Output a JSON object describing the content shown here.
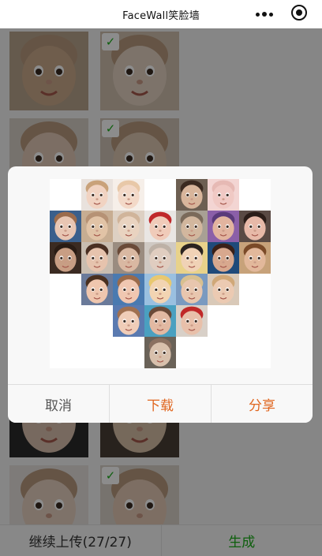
{
  "app": {
    "title": "FaceWall笑脸墙"
  },
  "titlebar": {
    "more_icon": "more-dots-icon",
    "capsule_icon": "target-circle-icon"
  },
  "grid": {
    "photos": [
      {
        "selected": false,
        "skin": "#caa98a",
        "bg": "#b9a48c"
      },
      {
        "selected": true,
        "skin": "#e3d2c2",
        "bg": "#cfc0ae"
      },
      {
        "selected": false,
        "skin": "#e2c8b6",
        "bg": "#d8cfc7"
      },
      {
        "selected": true,
        "skin": "#ddc6b1",
        "bg": "#cfc4b6"
      },
      {
        "selected": false,
        "skin": "#d9c0ad",
        "bg": "#2a2a2a"
      },
      {
        "selected": false,
        "skin": "#d7c0a7",
        "bg": "#4a3f36"
      },
      {
        "selected": false,
        "skin": "#e6cfc0",
        "bg": "#e6e0dc"
      },
      {
        "selected": true,
        "skin": "#e4c9b5",
        "bg": "#d9d2c8"
      }
    ],
    "check_mark": "✓"
  },
  "toolbar": {
    "continue_label": "继续上传(27/27)",
    "generate_label": "生成",
    "generate_color": "#1aad19"
  },
  "modal": {
    "cancel_label": "取消",
    "download_label": "下载",
    "share_label": "分享",
    "accent_color": "#e0661f",
    "faces": [
      {
        "skin": "#f1d3c2",
        "hair": "#c9a27a",
        "bg": "#e9e2dd"
      },
      {
        "skin": "#f3d9c8",
        "hair": "#e8c8a8",
        "bg": "#f6efe9"
      },
      {
        "skin": "#d8b59b",
        "hair": "#3b2a20",
        "bg": "#6d5f52"
      },
      {
        "skin": "#f0c9c4",
        "hair": "#e6b9b4",
        "bg": "#f3d5d3"
      },
      {
        "skin": "#e8c6b3",
        "hair": "#9b6b4c",
        "bg": "#3a5f8c"
      },
      {
        "skin": "#e1c3a6",
        "hair": "#b69275",
        "bg": "#c7ad92"
      },
      {
        "skin": "#e9d3c0",
        "hair": "#d0b49a",
        "bg": "#ddd0c3"
      },
      {
        "skin": "#f0cbb9",
        "hair": "#c0282a",
        "bg": "#e9e6e3"
      },
      {
        "skin": "#d2b79e",
        "hair": "#7a6a5a",
        "bg": "#a8a094"
      },
      {
        "skin": "#e2b49f",
        "hair": "#5a3a7a",
        "bg": "#8b5fa8"
      },
      {
        "skin": "#e7b9a8",
        "hair": "#2b1d18",
        "bg": "#5a4a44"
      },
      {
        "skin": "#c89e84",
        "hair": "#2a1c14",
        "bg": "#3b2b22"
      },
      {
        "skin": "#e6c3ad",
        "hair": "#4a2f22",
        "bg": "#c9bdb0"
      },
      {
        "skin": "#d9b8a2",
        "hair": "#6a4a38",
        "bg": "#9a8c80"
      },
      {
        "skin": "#e0cdc0",
        "hair": "#bdb1a6",
        "bg": "#cfc9c3"
      },
      {
        "skin": "#f0d2b6",
        "hair": "#2a2320",
        "bg": "#e8d28a"
      },
      {
        "skin": "#d8a88e",
        "hair": "#3a2018",
        "bg": "#1f4a7a"
      },
      {
        "skin": "#e2b89b",
        "hair": "#7a4a28",
        "bg": "#c7a27a"
      },
      {
        "skin": "#efc6ae",
        "hair": "#4a3020",
        "bg": "#6a7a9a"
      },
      {
        "skin": "#f0c7b1",
        "hair": "#9a6a4a",
        "bg": "#4a7ab0"
      },
      {
        "skin": "#f2d4b2",
        "hair": "#e8c870",
        "bg": "#9ac0e0"
      },
      {
        "skin": "#e8c6ae",
        "hair": "#d8c090",
        "bg": "#7a9ac0"
      },
      {
        "skin": "#eccab2",
        "hair": "#d0a878",
        "bg": "#d9c9b8"
      },
      {
        "skin": "#f0cdb8",
        "hair": "#a07050",
        "bg": "#5a7ab0"
      },
      {
        "skin": "#e2b9a2",
        "hair": "#6a4a38",
        "bg": "#4aa0c0"
      },
      {
        "skin": "#e8c0aa",
        "hair": "#c02828",
        "bg": "#d8d0c8"
      },
      {
        "skin": "#d8c0ac",
        "hair": "#8a7060",
        "bg": "#6a6258"
      }
    ]
  }
}
